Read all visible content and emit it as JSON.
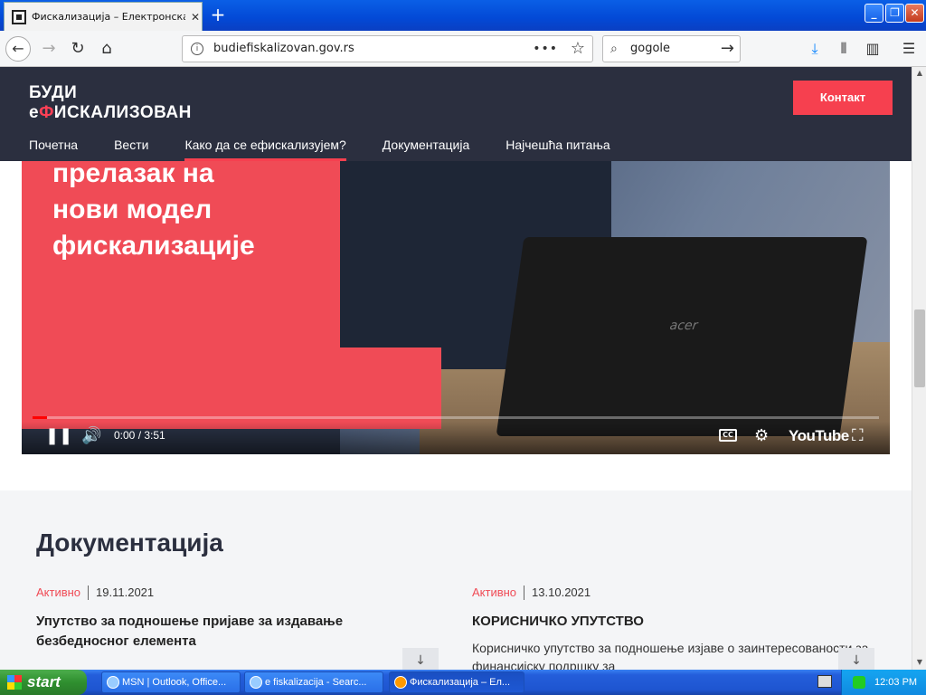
{
  "browser": {
    "tab_title": "Фискализација – Електронска ф",
    "tab_close": "✕",
    "new_tab": "+",
    "url": "budiefiskalizovan.gov.rs",
    "url_dots": "•••",
    "search_query": "gogole",
    "window_controls": {
      "minimize": "_",
      "restore": "❐",
      "close": "✕"
    }
  },
  "site": {
    "logo_line1": "БУДИ",
    "logo_line2_prefix": "е",
    "logo_line2_red": "Ф",
    "logo_line2_rest": "ИСКАЛИЗОВАН",
    "contact_button": "Контакт",
    "nav": [
      {
        "label": "Почетна"
      },
      {
        "label": "Вести"
      },
      {
        "label": "Како да се ефискализујем?",
        "active": true
      },
      {
        "label": "Документација"
      },
      {
        "label": "Најчешћа питања"
      }
    ],
    "accent_color": "#f6404f",
    "header_color": "#2b2f3f"
  },
  "video": {
    "overlay_text": [
      "прелазак на",
      "нови модел",
      "фискализације"
    ],
    "laptop_brand": "acer",
    "time": "0:00 / 3:51",
    "progress": 0.0,
    "youtube_label": "YouTube",
    "cc_label": "CC"
  },
  "docs": {
    "title": "Документација",
    "items": [
      {
        "status": "Активно",
        "date": "19.11.2021",
        "title": "Упутство за подношење пријаве за издавање безбедносног елемента",
        "description": ""
      },
      {
        "status": "Активно",
        "date": "13.10.2021",
        "title": "КОРИСНИЧКО УПУТСТВО",
        "description": "Корисничко упутство за подношење изјаве о заинтересованости за финансијску подршку за"
      }
    ]
  },
  "taskbar": {
    "start_label": "start",
    "tasks": [
      {
        "label": "MSN | Outlook, Office..."
      },
      {
        "label": "e fiskalizacija - Searc..."
      },
      {
        "label": "Фискализација – Ел...",
        "active": true
      }
    ],
    "clock": "12:03 PM"
  }
}
